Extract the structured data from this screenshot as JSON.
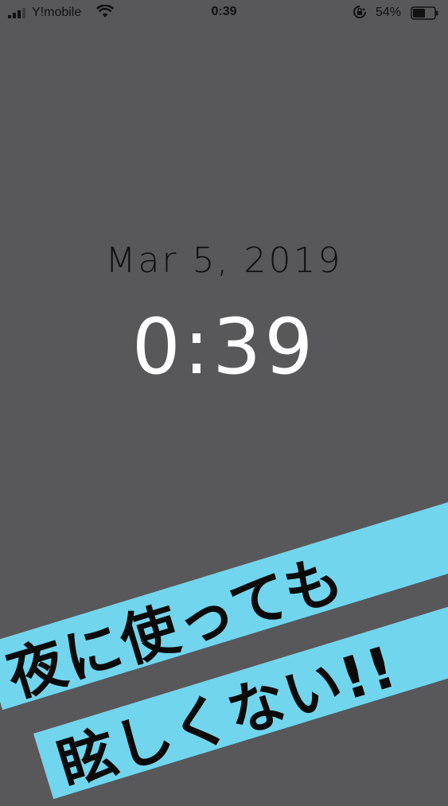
{
  "status_bar": {
    "carrier": "Y!mobile",
    "time": "0:39",
    "battery_percent": "54%"
  },
  "lock_screen": {
    "date": "Mar 5, 2019",
    "time": "0:39"
  },
  "overlay": {
    "line1": "夜に使っても",
    "line2": "眩しくない!!",
    "band_color": "#71d5ed"
  },
  "colors": {
    "background": "#58575a",
    "time_text": "#ffffff",
    "date_text": "#111111"
  }
}
